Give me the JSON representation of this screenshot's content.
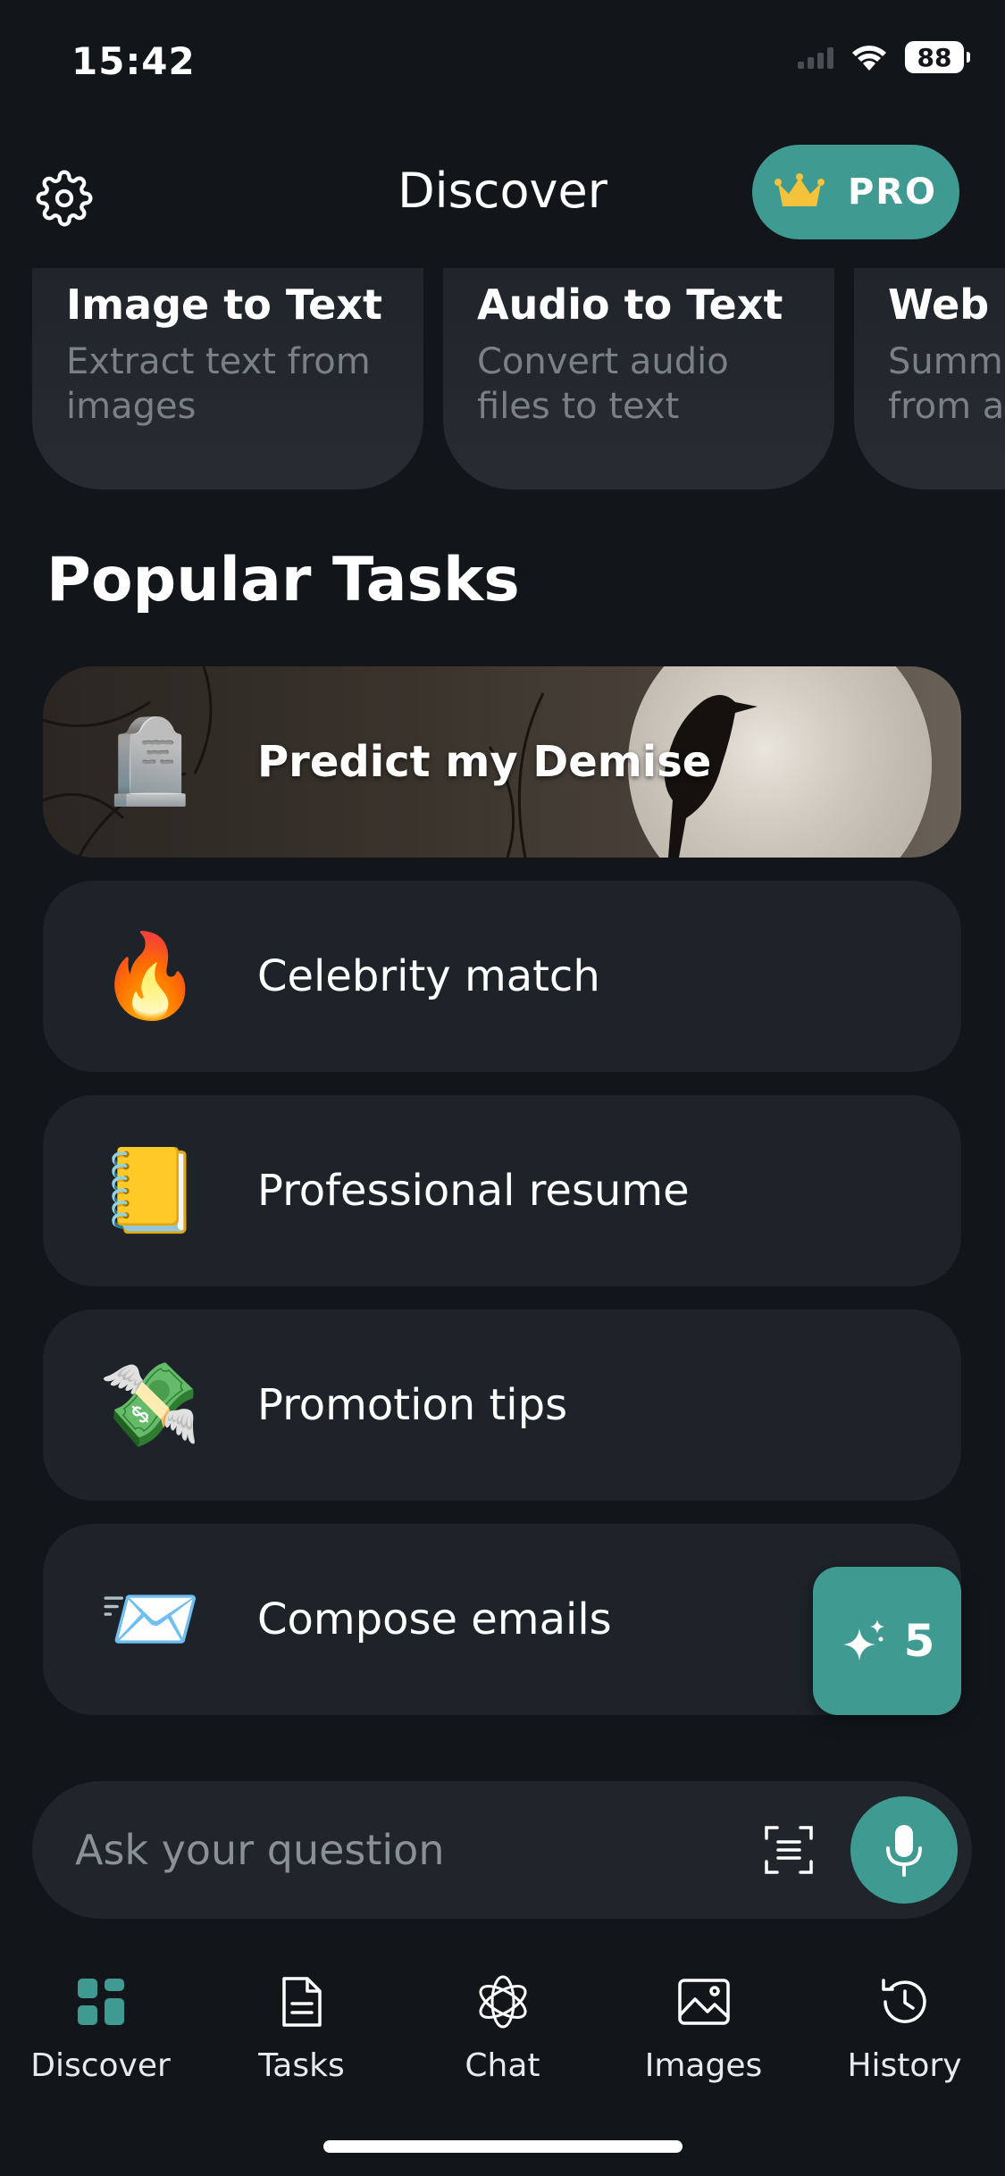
{
  "status_bar": {
    "time": "15:42",
    "battery": "88"
  },
  "header": {
    "title": "Discover",
    "pro_label": "PRO",
    "settings_icon": "gear-icon",
    "pro_icon": "crown-icon"
  },
  "features": [
    {
      "title": "Image to Text",
      "subtitle_line1": "Extract text from",
      "subtitle_line2": "images"
    },
    {
      "title": "Audio to Text",
      "subtitle_line1": "Convert audio",
      "subtitle_line2": "files to text"
    },
    {
      "title": "Web S",
      "subtitle_line1": "Summa",
      "subtitle_line2": "from ar"
    }
  ],
  "section_title": "Popular Tasks",
  "tasks": [
    {
      "label": "Predict my Demise",
      "emoji": "🪦",
      "icon": "headstone-icon",
      "featured": true
    },
    {
      "label": "Celebrity match",
      "emoji": "🔥",
      "icon": "fire-icon"
    },
    {
      "label": "Professional resume",
      "emoji": "📒",
      "icon": "notebook-icon"
    },
    {
      "label": "Promotion tips",
      "emoji": "💸",
      "icon": "money-wings-icon"
    },
    {
      "label": "Compose emails",
      "emoji": "📨",
      "icon": "inbox-envelope-icon"
    }
  ],
  "spark_button": {
    "count": "5",
    "icon": "sparkle-icon"
  },
  "ask_bar": {
    "placeholder": "Ask your question",
    "scan_icon": "scan-text-icon",
    "mic_icon": "microphone-icon"
  },
  "nav": [
    {
      "label": "Discover",
      "icon": "grid-icon",
      "active": true
    },
    {
      "label": "Tasks",
      "icon": "document-icon"
    },
    {
      "label": "Chat",
      "icon": "chat-logo-icon"
    },
    {
      "label": "Images",
      "icon": "image-icon"
    },
    {
      "label": "History",
      "icon": "history-icon"
    }
  ],
  "colors": {
    "background": "#12161b",
    "card": "#1e232a",
    "accent": "#3f9a92",
    "muted_text": "#7a8088",
    "active_nav": "#3f9a92"
  }
}
